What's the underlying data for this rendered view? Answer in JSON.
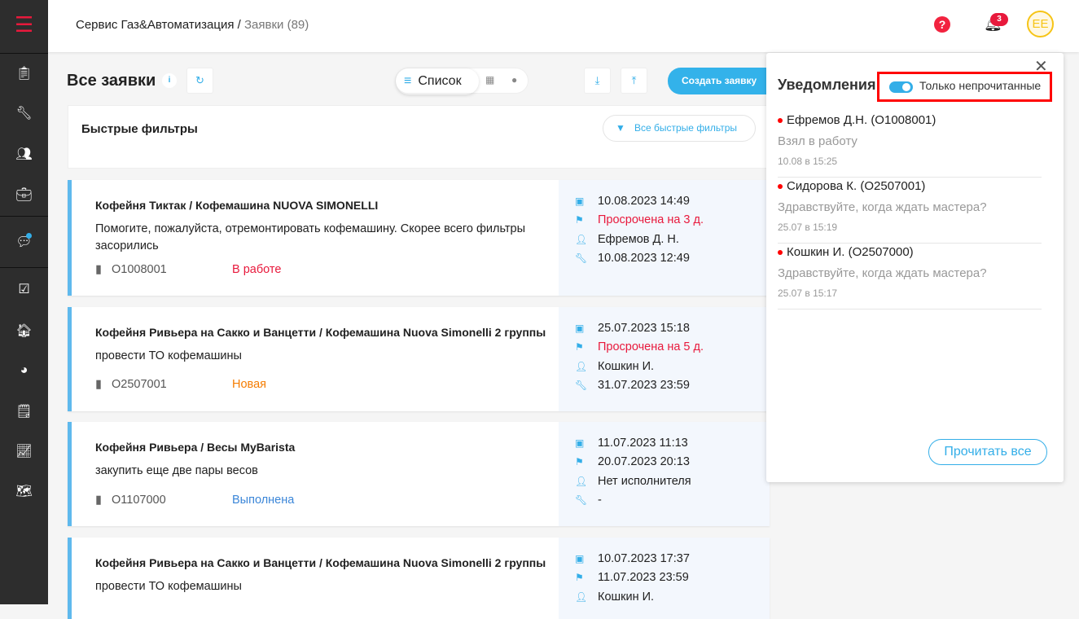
{
  "header": {
    "company": "Сервис Газ&Автоматизация",
    "separator": " / ",
    "section": "Заявки (89)",
    "notif_count": "3",
    "avatar": "EE",
    "help": "?"
  },
  "toolbar": {
    "title": "Все заявки",
    "view_list": "Список",
    "create": "Создать заявку"
  },
  "quick_filters": {
    "title": "Быстрые фильтры",
    "all": "Все быстрые фильтры"
  },
  "tickets": [
    {
      "title": "Кофейня Тиктак / Кофемашина NUOVA SIMONELLI",
      "desc": "Помогите, пожалуйста, отремонтировать кофемашину. Скорее всего фильтры засорились",
      "number": "O1008001",
      "status": "В работе",
      "created": "10.08.2023 14:49",
      "deadline": "Просрочена на 3 д.",
      "assignee": "Ефремов Д. Н.",
      "work": "10.08.2023 12:49"
    },
    {
      "title": "Кофейня Ривьера на Сакко и Ванцетти / Кофемашина Nuova Simonelli 2 группы",
      "desc": "провести ТО кофемашины",
      "number": "O2507001",
      "status": "Новая",
      "created": "25.07.2023 15:18",
      "deadline": "Просрочена на 5 д.",
      "assignee": "Кошкин И.",
      "work": "31.07.2023 23:59"
    },
    {
      "title": "Кофейня Ривьера / Весы MyBarista",
      "desc": "закупить еще две пары весов",
      "number": "O1107000",
      "status": "Выполнена",
      "created": "11.07.2023 11:13",
      "deadline": "20.07.2023 20:13",
      "assignee": "Нет исполнителя",
      "work": "-"
    },
    {
      "title": "Кофейня Ривьера на Сакко и Ванцетти / Кофемашина Nuova Simonelli 2 группы",
      "desc": "провести ТО кофемашины",
      "created": "10.07.2023 17:37",
      "deadline": "11.07.2023 23:59",
      "assignee": "Кошкин И."
    }
  ],
  "notifications": {
    "title": "Уведомления",
    "toggle_label": "Только непрочитанные",
    "toggle_on": true,
    "read_all": "Прочитать все",
    "items": [
      {
        "name": "Ефремов Д.Н. (O1008001)",
        "message": "Взял в работу",
        "time": "10.08 в 15:25"
      },
      {
        "name": "Сидорова К. (O2507001)",
        "message": "Здравствуйте, когда ждать мастера?",
        "time": "25.07 в 15:19"
      },
      {
        "name": "Кошкин И. (O2507000)",
        "message": "Здравствуйте, когда ждать мастера?",
        "time": "25.07 в 15:17"
      }
    ]
  },
  "colors": {
    "accent": "#33aee8",
    "danger": "#e8193c",
    "sidebar": "#2d2d2d"
  }
}
